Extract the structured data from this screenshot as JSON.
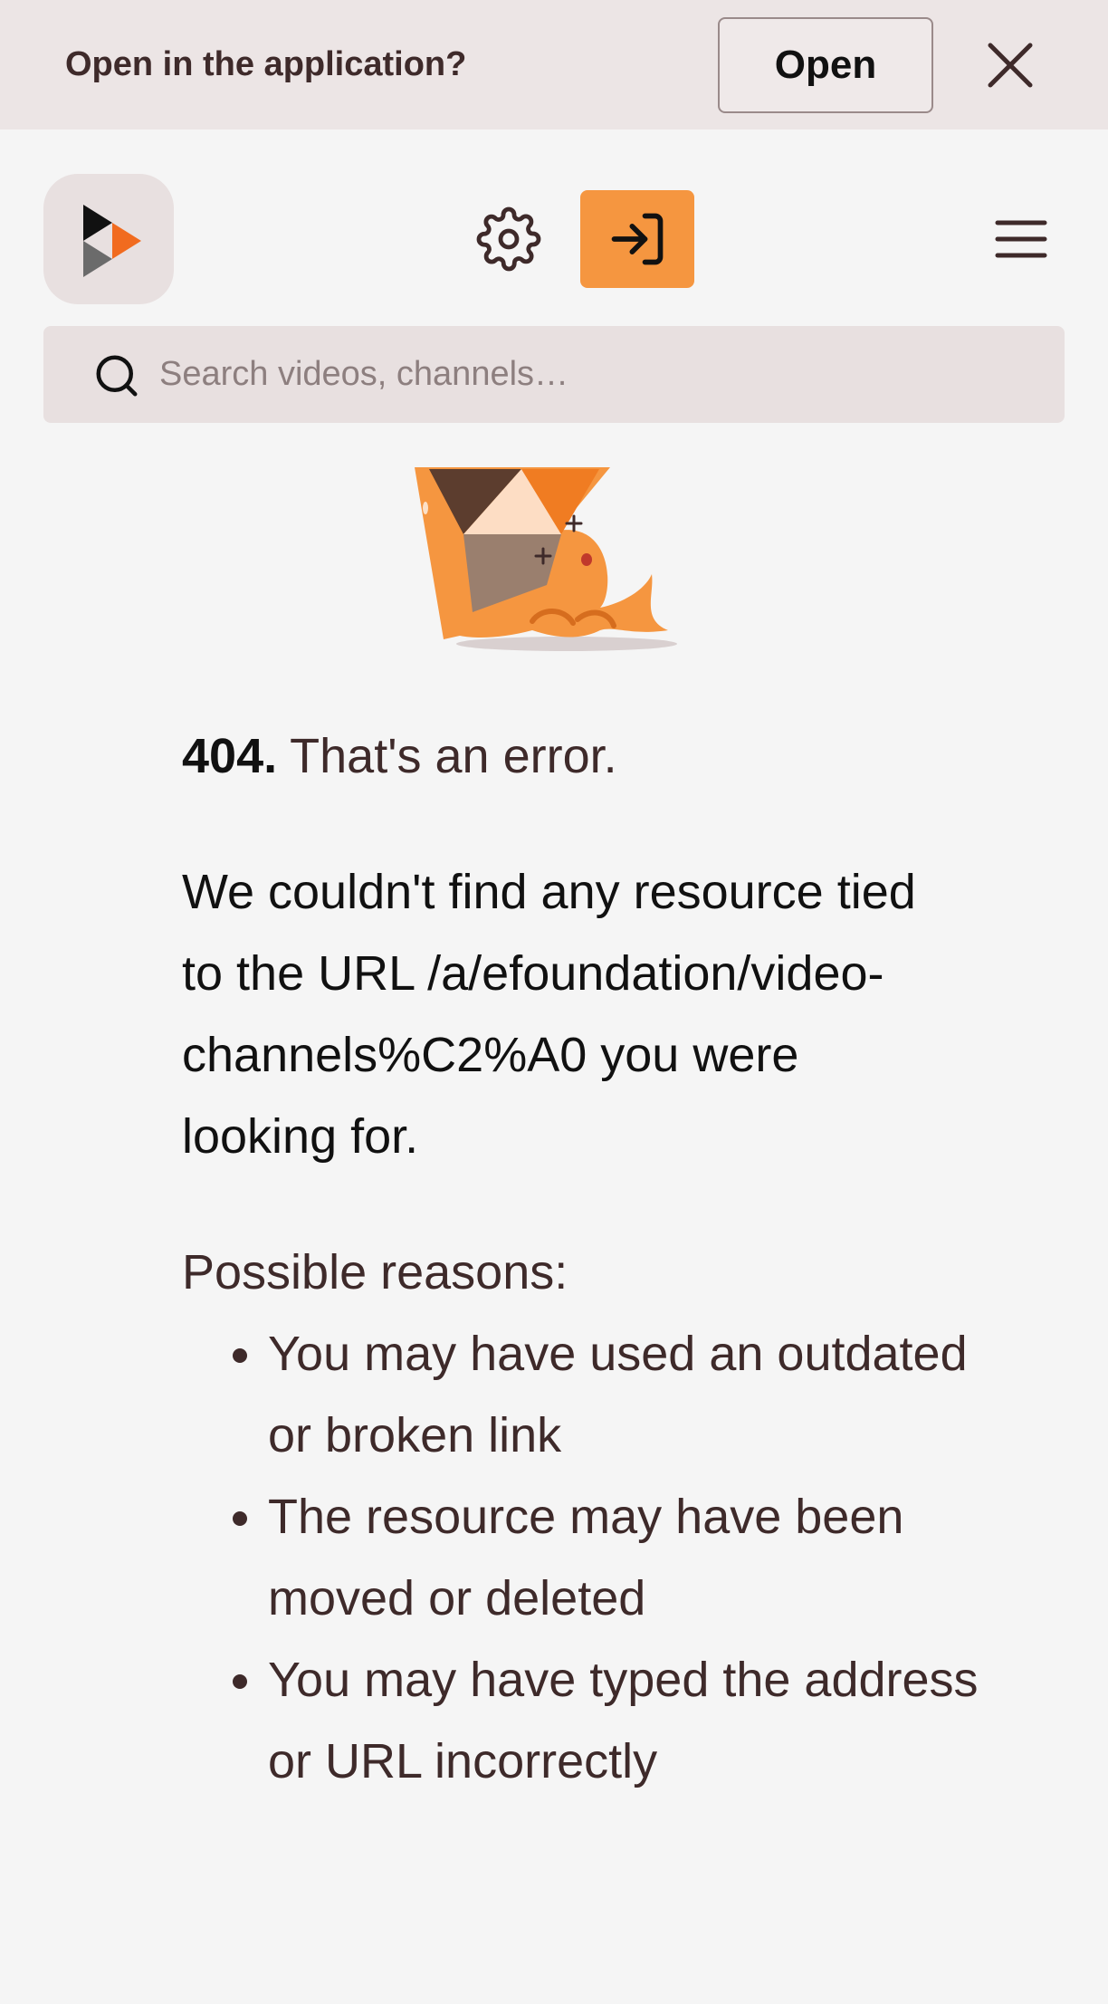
{
  "app_banner": {
    "text": "Open in the application?",
    "open_label": "Open"
  },
  "header": {
    "icons": [
      "peertube-logo-icon",
      "gear-icon",
      "login-icon",
      "hamburger-menu-icon"
    ]
  },
  "search": {
    "placeholder": "Search videos, channels…"
  },
  "error": {
    "code": "404.",
    "title": "That's an error.",
    "message": "We couldn't find any resource tied to the URL /a/efoundation/video-channels%C2%A0 you were looking for.",
    "reasons_title": "Possible reasons:",
    "reasons": [
      "You may have used an outdated or broken link",
      "The resource may have been moved or deleted",
      "You may have typed the address or URL incorrectly"
    ]
  },
  "colors": {
    "accent": "#f59640",
    "background": "#f5f5f5",
    "banner": "#ece5e5",
    "text": "#3e2a2a"
  }
}
